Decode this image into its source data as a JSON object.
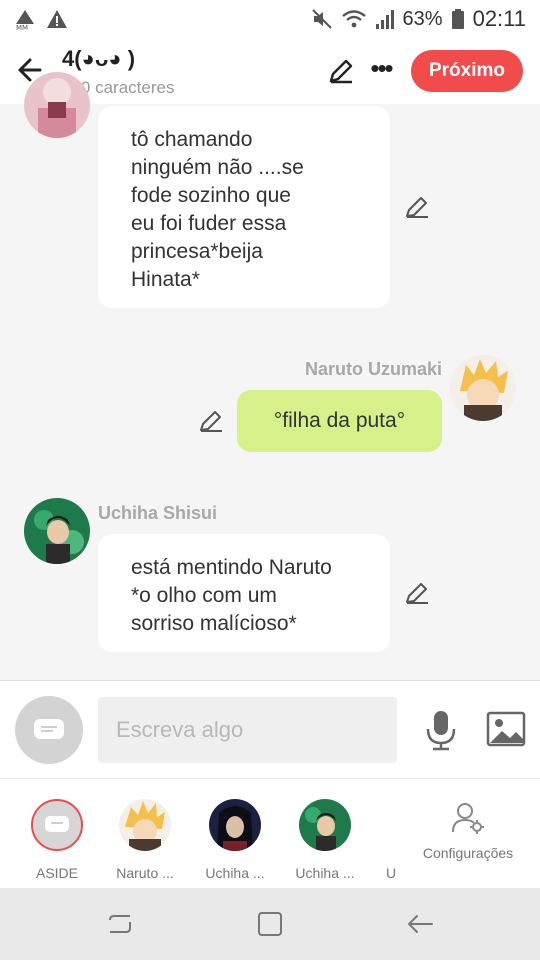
{
  "status": {
    "time": "02:11",
    "battery": "63%"
  },
  "header": {
    "title": "4(◕ᴗ◕ )",
    "subtitle": "590 caracteres",
    "next_label": "Próximo"
  },
  "messages": [
    {
      "author": "",
      "text": "tô chamando\nninguém não ....se\nfode sozinho que\neu foi fuder essa\nprincesa*beija\nHinata*"
    },
    {
      "author": "Naruto Uzumaki",
      "text": "°filha da puta°"
    },
    {
      "author": "Uchiha Shisui",
      "text": "está mentindo Naruto\n*o olho com um\nsorriso malícioso*"
    }
  ],
  "composer": {
    "placeholder": "Escreva algo"
  },
  "tabs": [
    {
      "label": "ASIDE"
    },
    {
      "label": "Naruto ..."
    },
    {
      "label": "Uchiha ..."
    },
    {
      "label": "Uchiha ..."
    },
    {
      "label": "U"
    },
    {
      "label": "Configurações"
    }
  ],
  "colors": {
    "accent": "#f14b4b",
    "my_bubble": "#d6f08a"
  }
}
